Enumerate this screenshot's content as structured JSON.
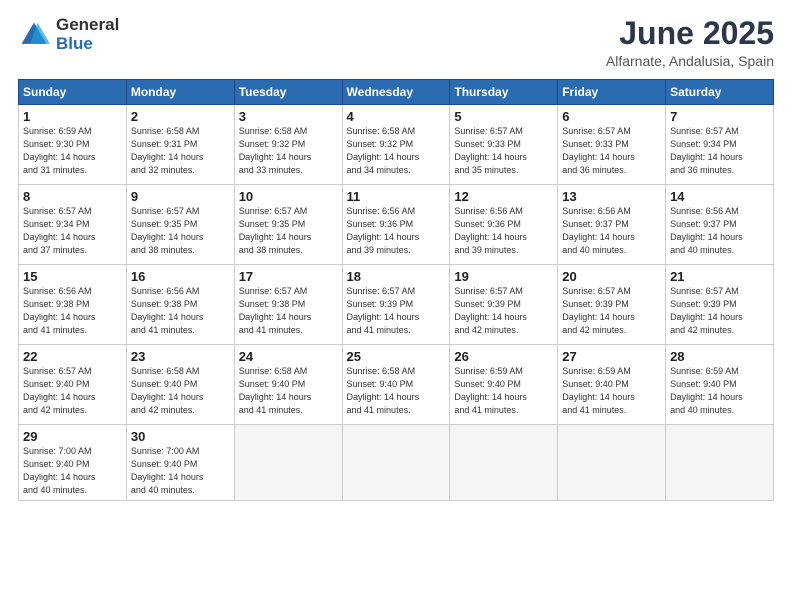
{
  "logo": {
    "general": "General",
    "blue": "Blue"
  },
  "title": {
    "month": "June 2025",
    "location": "Alfarnate, Andalusia, Spain"
  },
  "headers": [
    "Sunday",
    "Monday",
    "Tuesday",
    "Wednesday",
    "Thursday",
    "Friday",
    "Saturday"
  ],
  "weeks": [
    [
      {
        "day": "1",
        "info": "Sunrise: 6:59 AM\nSunset: 9:30 PM\nDaylight: 14 hours\nand 31 minutes."
      },
      {
        "day": "2",
        "info": "Sunrise: 6:58 AM\nSunset: 9:31 PM\nDaylight: 14 hours\nand 32 minutes."
      },
      {
        "day": "3",
        "info": "Sunrise: 6:58 AM\nSunset: 9:32 PM\nDaylight: 14 hours\nand 33 minutes."
      },
      {
        "day": "4",
        "info": "Sunrise: 6:58 AM\nSunset: 9:32 PM\nDaylight: 14 hours\nand 34 minutes."
      },
      {
        "day": "5",
        "info": "Sunrise: 6:57 AM\nSunset: 9:33 PM\nDaylight: 14 hours\nand 35 minutes."
      },
      {
        "day": "6",
        "info": "Sunrise: 6:57 AM\nSunset: 9:33 PM\nDaylight: 14 hours\nand 36 minutes."
      },
      {
        "day": "7",
        "info": "Sunrise: 6:57 AM\nSunset: 9:34 PM\nDaylight: 14 hours\nand 36 minutes."
      }
    ],
    [
      {
        "day": "8",
        "info": "Sunrise: 6:57 AM\nSunset: 9:34 PM\nDaylight: 14 hours\nand 37 minutes."
      },
      {
        "day": "9",
        "info": "Sunrise: 6:57 AM\nSunset: 9:35 PM\nDaylight: 14 hours\nand 38 minutes."
      },
      {
        "day": "10",
        "info": "Sunrise: 6:57 AM\nSunset: 9:35 PM\nDaylight: 14 hours\nand 38 minutes."
      },
      {
        "day": "11",
        "info": "Sunrise: 6:56 AM\nSunset: 9:36 PM\nDaylight: 14 hours\nand 39 minutes."
      },
      {
        "day": "12",
        "info": "Sunrise: 6:56 AM\nSunset: 9:36 PM\nDaylight: 14 hours\nand 39 minutes."
      },
      {
        "day": "13",
        "info": "Sunrise: 6:56 AM\nSunset: 9:37 PM\nDaylight: 14 hours\nand 40 minutes."
      },
      {
        "day": "14",
        "info": "Sunrise: 6:56 AM\nSunset: 9:37 PM\nDaylight: 14 hours\nand 40 minutes."
      }
    ],
    [
      {
        "day": "15",
        "info": "Sunrise: 6:56 AM\nSunset: 9:38 PM\nDaylight: 14 hours\nand 41 minutes."
      },
      {
        "day": "16",
        "info": "Sunrise: 6:56 AM\nSunset: 9:38 PM\nDaylight: 14 hours\nand 41 minutes."
      },
      {
        "day": "17",
        "info": "Sunrise: 6:57 AM\nSunset: 9:38 PM\nDaylight: 14 hours\nand 41 minutes."
      },
      {
        "day": "18",
        "info": "Sunrise: 6:57 AM\nSunset: 9:39 PM\nDaylight: 14 hours\nand 41 minutes."
      },
      {
        "day": "19",
        "info": "Sunrise: 6:57 AM\nSunset: 9:39 PM\nDaylight: 14 hours\nand 42 minutes."
      },
      {
        "day": "20",
        "info": "Sunrise: 6:57 AM\nSunset: 9:39 PM\nDaylight: 14 hours\nand 42 minutes."
      },
      {
        "day": "21",
        "info": "Sunrise: 6:57 AM\nSunset: 9:39 PM\nDaylight: 14 hours\nand 42 minutes."
      }
    ],
    [
      {
        "day": "22",
        "info": "Sunrise: 6:57 AM\nSunset: 9:40 PM\nDaylight: 14 hours\nand 42 minutes."
      },
      {
        "day": "23",
        "info": "Sunrise: 6:58 AM\nSunset: 9:40 PM\nDaylight: 14 hours\nand 42 minutes."
      },
      {
        "day": "24",
        "info": "Sunrise: 6:58 AM\nSunset: 9:40 PM\nDaylight: 14 hours\nand 41 minutes."
      },
      {
        "day": "25",
        "info": "Sunrise: 6:58 AM\nSunset: 9:40 PM\nDaylight: 14 hours\nand 41 minutes."
      },
      {
        "day": "26",
        "info": "Sunrise: 6:59 AM\nSunset: 9:40 PM\nDaylight: 14 hours\nand 41 minutes."
      },
      {
        "day": "27",
        "info": "Sunrise: 6:59 AM\nSunset: 9:40 PM\nDaylight: 14 hours\nand 41 minutes."
      },
      {
        "day": "28",
        "info": "Sunrise: 6:59 AM\nSunset: 9:40 PM\nDaylight: 14 hours\nand 40 minutes."
      }
    ],
    [
      {
        "day": "29",
        "info": "Sunrise: 7:00 AM\nSunset: 9:40 PM\nDaylight: 14 hours\nand 40 minutes."
      },
      {
        "day": "30",
        "info": "Sunrise: 7:00 AM\nSunset: 9:40 PM\nDaylight: 14 hours\nand 40 minutes."
      },
      {
        "day": "",
        "info": ""
      },
      {
        "day": "",
        "info": ""
      },
      {
        "day": "",
        "info": ""
      },
      {
        "day": "",
        "info": ""
      },
      {
        "day": "",
        "info": ""
      }
    ]
  ]
}
